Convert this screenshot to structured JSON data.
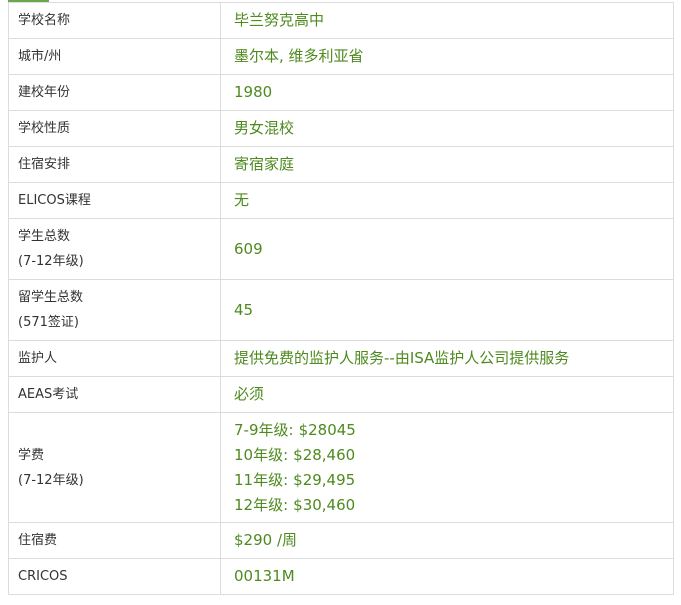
{
  "rows": [
    {
      "label": "学校名称",
      "value": "毕兰努克高中"
    },
    {
      "label": "城市/州",
      "value": "墨尔本, 维多利亚省"
    },
    {
      "label": "建校年份",
      "value": "1980"
    },
    {
      "label": "学校性质",
      "value": "男女混校"
    },
    {
      "label": "住宿安排",
      "value": "寄宿家庭"
    },
    {
      "label": "ELICOS课程",
      "value": "无"
    },
    {
      "label": "学生总数",
      "label_sub": "(7-12年级)",
      "value": "609"
    },
    {
      "label": "留学生总数",
      "label_sub": "(571签证)",
      "value": "45"
    },
    {
      "label": "监护人",
      "value": "提供免费的监护人服务--由ISA监护人公司提供服务"
    },
    {
      "label": "AEAS考试",
      "value": "必须"
    },
    {
      "label": "学费",
      "label_sub": "(7-12年级)",
      "fees": [
        {
          "grade": "7-9年级:",
          "amount": "$28045"
        },
        {
          "grade": "10年级:",
          "amount": "$28,460"
        },
        {
          "grade": "11年级:",
          "amount": "$29,495"
        },
        {
          "grade": "12年级:",
          "amount": "$30,460"
        }
      ]
    },
    {
      "label": "住宿费",
      "value": "$290 /周"
    },
    {
      "label": "CRICOS",
      "value": "00131M"
    }
  ]
}
